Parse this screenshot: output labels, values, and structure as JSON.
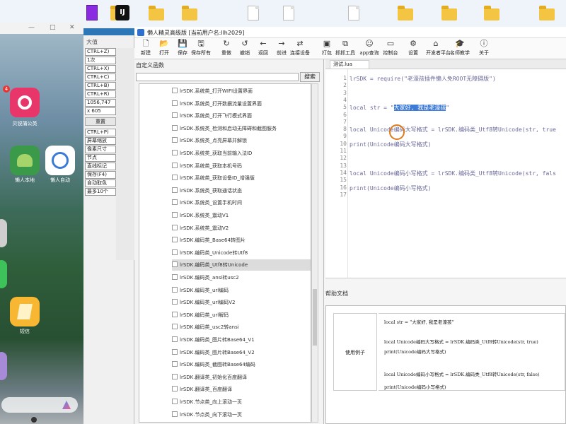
{
  "desktop": {
    "icons": [
      {
        "kind": "zip",
        "label": ""
      },
      {
        "kind": "folder",
        "label": ""
      },
      {
        "kind": "app",
        "label": "",
        "glyph": "IJ"
      },
      {
        "kind": "folder",
        "label": ""
      },
      {
        "kind": "folder",
        "label": ""
      },
      {
        "kind": "file",
        "label": ""
      },
      {
        "kind": "file",
        "label": ""
      },
      {
        "kind": "file",
        "label": ""
      },
      {
        "kind": "folder",
        "label": ""
      },
      {
        "kind": "folder",
        "label": ""
      },
      {
        "kind": "folder",
        "label": ""
      },
      {
        "kind": "folder",
        "label": ""
      }
    ]
  },
  "phone": {
    "window_buttons": [
      "—",
      "□",
      "✕"
    ],
    "status": "",
    "apps": [
      {
        "label": "贝锐蒲公英",
        "color": "#e8366a"
      },
      {
        "label": "懒人本地",
        "color": "#3a9a4a"
      },
      {
        "label": "懒人自动",
        "color": "#ffffff"
      },
      {
        "label": "短信",
        "color": "#f7b733"
      }
    ],
    "badge": "4"
  },
  "left_tools": {
    "header": "大值",
    "rows": [
      "CTRL+Z)",
      "1次",
      "CTRL+X)",
      "CTRL+C)",
      "CTRL+B)",
      "CTRL+R)",
      "1056,747",
      "x 605"
    ],
    "button_reset": "重置",
    "rows2": [
      "CTRL+P)",
      "屏幕缩放",
      "像素尺寸",
      "节点",
      "直线标记",
      "保存(F4)",
      "自动取色",
      "最多10个"
    ]
  },
  "ide": {
    "title": "懒人精灵高级版 [当前用户名:llh2029]",
    "toolbar": [
      {
        "icon": "new-icon",
        "glyph": "🗋",
        "label": "新建"
      },
      {
        "icon": "open-icon",
        "glyph": "📂",
        "label": "打开"
      },
      {
        "icon": "save-icon",
        "glyph": "💾",
        "label": "保存"
      },
      {
        "icon": "save-all-icon",
        "glyph": "🖫",
        "label": "保存所有"
      },
      {
        "icon": "redo-icon",
        "glyph": "↻",
        "label": "重做"
      },
      {
        "icon": "undo-icon",
        "glyph": "↺",
        "label": "撤销"
      },
      {
        "icon": "back-icon",
        "glyph": "←",
        "label": "返回"
      },
      {
        "icon": "forward-icon",
        "glyph": "→",
        "label": "前进"
      },
      {
        "icon": "connect-icon",
        "glyph": "⇄",
        "label": "连接设备"
      },
      {
        "icon": "package-icon",
        "glyph": "▣",
        "label": "打包"
      },
      {
        "icon": "capture-icon",
        "glyph": "⧉",
        "label": "抓抓工具"
      },
      {
        "icon": "app-query-icon",
        "glyph": "☺",
        "label": "app查询"
      },
      {
        "icon": "console-icon",
        "glyph": "▭",
        "label": "控制台"
      },
      {
        "icon": "settings-icon",
        "glyph": "⚙",
        "label": "设置"
      },
      {
        "icon": "developer-icon",
        "glyph": "⌂",
        "label": "开发者平台"
      },
      {
        "icon": "teacher-icon",
        "glyph": "🎓",
        "label": "名师教学"
      },
      {
        "icon": "about-icon",
        "glyph": "ⓘ",
        "label": "关于"
      }
    ],
    "func_panel_title": "自定义函数",
    "search_button": "搜索",
    "functions": [
      "lrSDK.系统类_打开WIFI设置界面",
      "lrSDK.系统类_打开数据流量设置界面",
      "lrSDK.系统类_打开飞行模式界面",
      "lrSDK.系统类_检测和启动无障碍和截图服务",
      "lrSDK.系统类_点亮屏幕并解锁",
      "lrSDK.系统类_获取当前输入法ID",
      "lrSDK.系统类_获取本机号码",
      "lrSDK.系统类_获取设备ID_增强版",
      "lrSDK.系统类_获取通话状态",
      "lrSDK.系统类_设置手机时间",
      "lrSDK.系统类_震动V1",
      "lrSDK.系统类_震动V2",
      "lrSDK.编码类_Base64转图片",
      "lrSDK.编码类_Unicode转Utf8",
      "lrSDK.编码类_Utf8转Unicode",
      "lrSDK.编码类_ansi转usc2",
      "lrSDK.编码类_url编码",
      "lrSDK.编码类_url编码V2",
      "lrSDK.编码类_url解码",
      "lrSDK.编码类_usc2转ansi",
      "lrSDK.编码类_图片转Base64_V1",
      "lrSDK.编码类_图片转Base64_V2",
      "lrSDK.编码类_截图转Base64编码",
      "lrSDK.翻译类_初始化百度翻译",
      "lrSDK.翻译类_百度翻译",
      "lrSDK.节点类_向上滚动一页",
      "lrSDK.节点类_向下滚动一页"
    ],
    "selected_function_index": 14,
    "editor_tab": "测试.lua",
    "code_lines": [
      {
        "n": "1",
        "text": "lrSDK = require(\"老濠孩插件懒人免ROOT无障碍版\")"
      },
      {
        "n": "2",
        "text": ""
      },
      {
        "n": "3",
        "text": ""
      },
      {
        "n": "4",
        "text": ""
      },
      {
        "n": "5",
        "pre": "local str = \"",
        "hl": "大家好, 我是老濠孩",
        "post": "\""
      },
      {
        "n": "6",
        "text": ""
      },
      {
        "n": "7",
        "text": ""
      },
      {
        "n": "8",
        "text": "local Unicode编码大写格式 = lrSDK.编码类_Utf8转Unicode(str, true"
      },
      {
        "n": "9",
        "text": ""
      },
      {
        "n": "10",
        "text": "print(Unicode编码大写格式)"
      },
      {
        "n": "11",
        "text": ""
      },
      {
        "n": "12",
        "text": ""
      },
      {
        "n": "13",
        "text": ""
      },
      {
        "n": "14",
        "text": "local Unicode编码小写格式 = lrSDK.编码类_Utf8转Unicode(str, fals"
      },
      {
        "n": "15",
        "text": ""
      },
      {
        "n": "16",
        "text": "print(Unicode编码小写格式)"
      },
      {
        "n": "17",
        "text": ""
      }
    ],
    "help_title": "帮助文档",
    "help_label": "使用例子",
    "help_lines": [
      "local str = \"大家好, 我是老濠孩\"",
      "local Unicode编码大写格式 = lrSDK.编码类_Utf8转Unicode(str, true)",
      "print(Unicode编码大写格式)",
      "local Unicode编码小写格式 = lrSDK.编码类_Utf8转Unicode(str, false)",
      "print(Unicode编码小写格式)"
    ]
  }
}
